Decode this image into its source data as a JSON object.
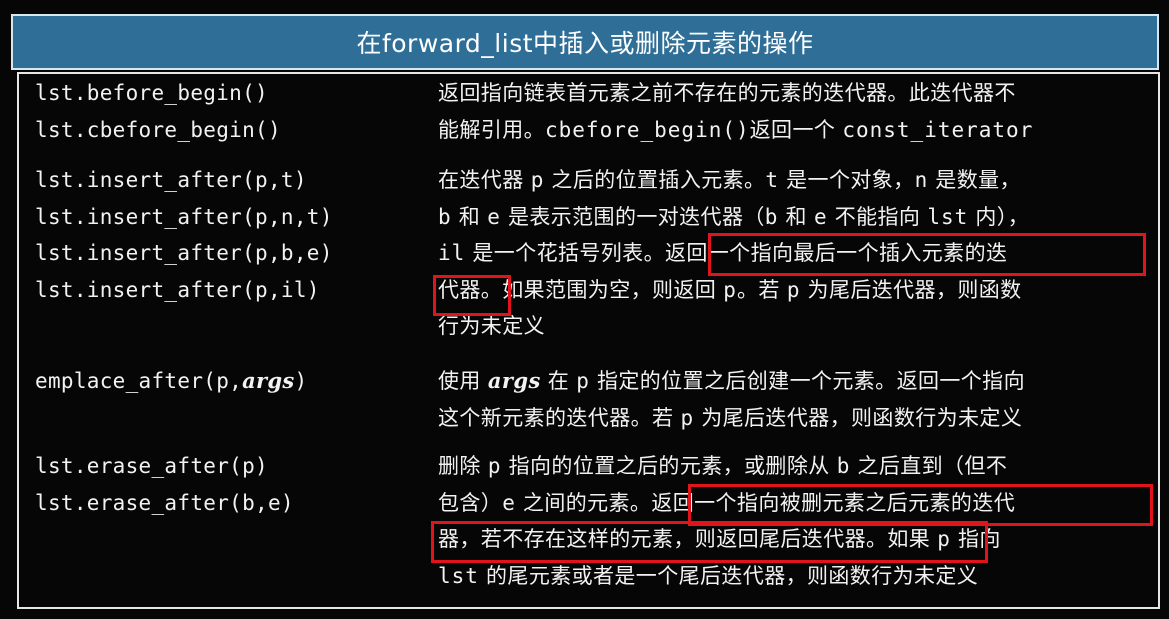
{
  "title": "在forward_list中插入或删除元素的操作",
  "rows": [
    {
      "code": [
        "lst.before_begin()",
        "lst.cbefore_begin()"
      ],
      "desc": [
        [
          {
            "t": "返回指向链表首元素之前不存在的元素的迭代器。此迭代器不"
          }
        ],
        [
          {
            "t": "能解引用。"
          },
          {
            "t": "cbefore_begin()",
            "m": true
          },
          {
            "t": "返回一个 "
          },
          {
            "t": "const_iterator",
            "m": true
          }
        ]
      ]
    },
    {
      "code": [
        "lst.insert_after(p,t)",
        "lst.insert_after(p,n,t)",
        "lst.insert_after(p,b,e)",
        "lst.insert_after(p,il)"
      ],
      "desc": [
        [
          {
            "t": "在迭代器 "
          },
          {
            "t": "p",
            "m": true
          },
          {
            "t": " 之后的位置插入元素。"
          },
          {
            "t": "t",
            "m": true
          },
          {
            "t": " 是一个对象，"
          },
          {
            "t": "n",
            "m": true
          },
          {
            "t": " 是数量，"
          }
        ],
        [
          {
            "t": "b",
            "m": true
          },
          {
            "t": " 和 "
          },
          {
            "t": "e",
            "m": true
          },
          {
            "t": " 是表示范围的一对迭代器（"
          },
          {
            "t": "b",
            "m": true
          },
          {
            "t": " 和 "
          },
          {
            "t": "e",
            "m": true
          },
          {
            "t": " 不能指向 "
          },
          {
            "t": "lst",
            "m": true
          },
          {
            "t": " 内），"
          }
        ],
        [
          {
            "t": "il",
            "m": true
          },
          {
            "t": " 是一个花括号列表。返回一个指向最后一个插入元素的迭"
          }
        ],
        [
          {
            "t": "代器。如果范围为空，则返回 "
          },
          {
            "t": "p",
            "m": true
          },
          {
            "t": "。若 "
          },
          {
            "t": "p",
            "m": true
          },
          {
            "t": " 为尾后迭代器，则函数"
          }
        ],
        [
          {
            "t": "行为未定义"
          }
        ]
      ]
    },
    {
      "code": [
        [
          {
            "t": "emplace_after(p,"
          },
          {
            "t": "args",
            "i": true
          },
          {
            "t": ")"
          }
        ]
      ],
      "desc": [
        [
          {
            "t": "使用 "
          },
          {
            "t": "args",
            "i": true
          },
          {
            "t": " 在 "
          },
          {
            "t": "p",
            "m": true
          },
          {
            "t": " 指定的位置之后创建一个元素。返回一个指向"
          }
        ],
        [
          {
            "t": "这个新元素的迭代器。若 "
          },
          {
            "t": "p",
            "m": true
          },
          {
            "t": " 为尾后迭代器，则函数行为未定义"
          }
        ]
      ]
    },
    {
      "code": [
        "lst.erase_after(p)",
        "lst.erase_after(b,e)"
      ],
      "desc": [
        [
          {
            "t": "删除 "
          },
          {
            "t": "p",
            "m": true
          },
          {
            "t": " 指向的位置之后的元素，或删除从 "
          },
          {
            "t": "b",
            "m": true
          },
          {
            "t": " 之后直到（但不"
          }
        ],
        [
          {
            "t": "包含）"
          },
          {
            "t": "e",
            "m": true
          },
          {
            "t": " 之间的元素。返回一个指向被删元素之后元素的迭代"
          }
        ],
        [
          {
            "t": "器，若不存在这样的元素，则返回尾后迭代器。如果 "
          },
          {
            "t": "p",
            "m": true
          },
          {
            "t": " 指向"
          }
        ],
        [
          {
            "t": "lst",
            "m": true
          },
          {
            "t": " 的尾元素或者是一个尾后迭代器，则函数行为未定义"
          }
        ]
      ]
    }
  ],
  "highlight_color": "#e0141b",
  "title_bg": "#2f6f97"
}
